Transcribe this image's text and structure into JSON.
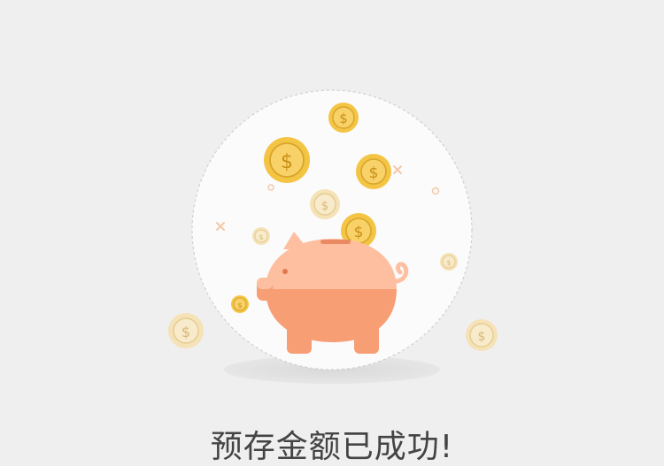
{
  "success": {
    "message": "预存金额已成功!",
    "illustration_icon": "piggy-bank-coins-icon"
  },
  "colors": {
    "background": "#efefef",
    "circle": "#fbfbfb",
    "pig_light": "#fdbf9f",
    "pig_dark": "#f79e75",
    "coin_gold": "#f4c444",
    "coin_pale": "#f4dca6",
    "text": "#444444"
  }
}
